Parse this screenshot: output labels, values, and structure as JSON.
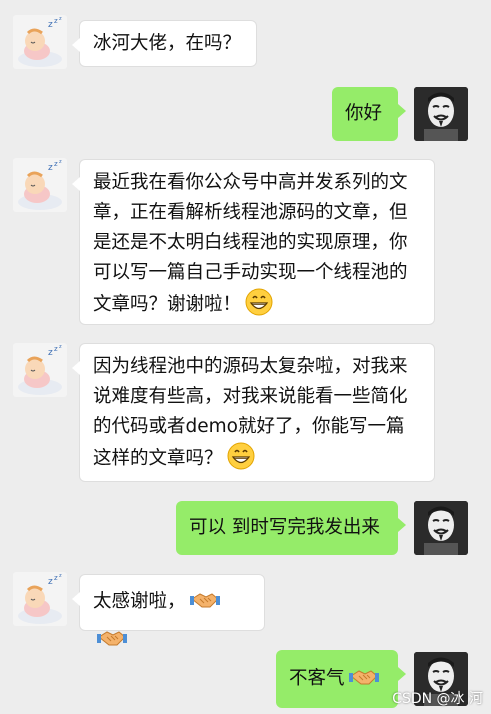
{
  "conversation": {
    "messages": [
      {
        "sender": "bingo",
        "text": "冰河大佬，在吗？"
      },
      {
        "sender": "me",
        "text": "你好"
      },
      {
        "sender": "bingo",
        "text": "最近我在看你公众号中高并发系列的文章，正在看解析线程池源码的文章，但是还是不太明白线程池的实现原理，你可以写一篇自己手动实现一个线程池的文章吗？谢谢啦！",
        "emoji": "grinning-face-icon"
      },
      {
        "sender": "bingo",
        "text": "因为线程池中的源码太复杂啦，对我来说难度有些高，对我来说能看一些简化的代码或者demo就好了，你能写一篇这样的文章吗？",
        "emoji": "grinning-face-icon"
      },
      {
        "sender": "me",
        "text": "可以 到时写完我发出来"
      },
      {
        "sender": "bingo",
        "text": "太感谢啦，",
        "emoji": "handshake-icon x2"
      },
      {
        "sender": "me",
        "text": "不客气",
        "emoji": "handshake-icon"
      }
    ]
  },
  "watermark": "CSDN @冰 河",
  "colors": {
    "background": "#ededed",
    "incoming_bubble": "#ffffff",
    "outgoing_bubble": "#95ec69"
  }
}
